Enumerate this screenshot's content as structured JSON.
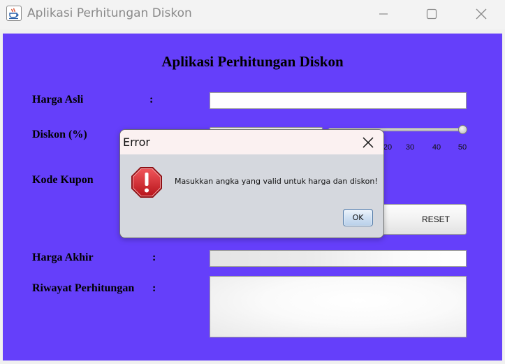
{
  "window": {
    "title": "Aplikasi Perhitungan Diskon",
    "icon": "java-cup-icon",
    "controls": [
      "minimize-icon",
      "maximize-icon",
      "close-icon"
    ]
  },
  "form": {
    "heading": "Aplikasi Perhitungan Diskon",
    "harga_asli_label": "Harga Asli",
    "harga_asli_value": "",
    "diskon_label": "Diskon (%)",
    "slider": {
      "value": 50,
      "ticks_visible": [
        "20",
        "30",
        "40",
        "50"
      ]
    },
    "kode_kupon_label": "Kode Kupon",
    "reset_label": "RESET",
    "harga_akhir_label": "Harga Akhir",
    "harga_akhir_value": "",
    "riwayat_label": "Riwayat Perhitungan",
    "riwayat_value": "",
    "colon": ":"
  },
  "dialog": {
    "title": "Error",
    "message": "Masukkan angka yang valid untuk harga dan diskon!",
    "ok_label": "OK",
    "icon": "error-octagon-icon"
  },
  "colors": {
    "panel_bg": "#653ffa",
    "error_icon": "#d2262c",
    "ok_button_border": "#5179a6"
  }
}
